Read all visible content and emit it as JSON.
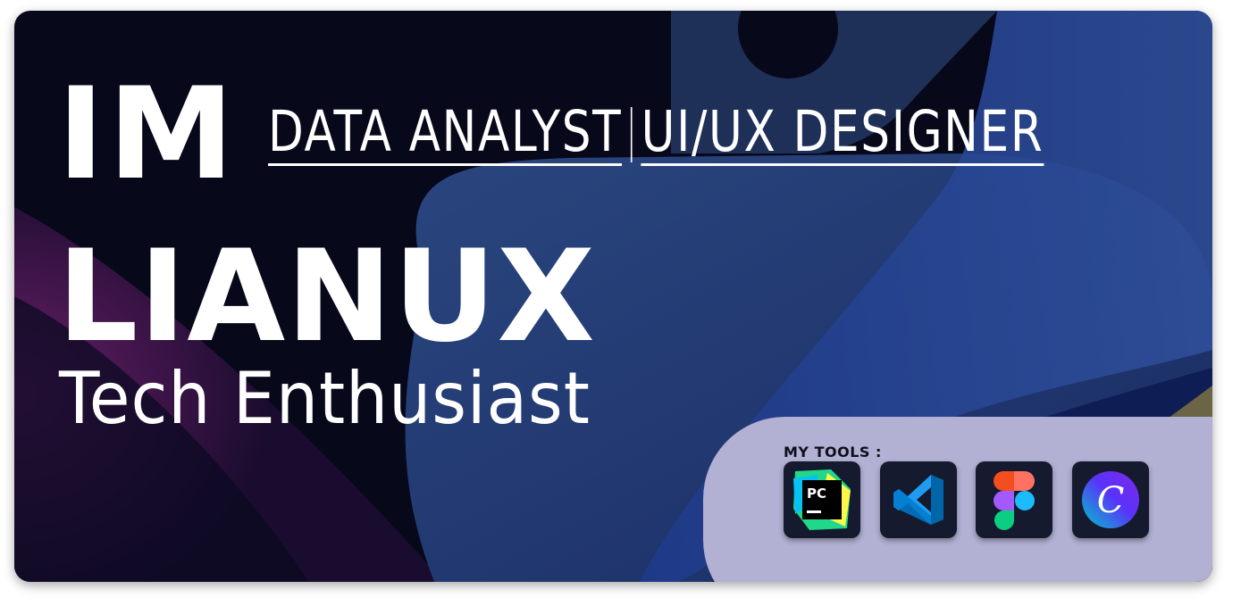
{
  "hero": {
    "line1": "IM",
    "line2": "LIANUX",
    "tagline": "Tech Enthusiast"
  },
  "roles": [
    {
      "label": "DATA ANALYST"
    },
    {
      "label": "UI/UX DESIGNER"
    }
  ],
  "tools": {
    "label": "MY TOOLS :",
    "items": [
      {
        "name": "PyCharm",
        "icon": "pycharm-icon",
        "badge": "PC"
      },
      {
        "name": "Visual Studio Code",
        "icon": "vscode-icon"
      },
      {
        "name": "Figma",
        "icon": "figma-icon"
      },
      {
        "name": "Canva",
        "icon": "canva-icon",
        "badge": "C"
      }
    ]
  },
  "colors": {
    "background": "#07081a",
    "panel": "#b2b0d3",
    "text": "#ffffff",
    "python_shape": "#2b4a86",
    "magenta_glow": "#5a1c5e"
  }
}
